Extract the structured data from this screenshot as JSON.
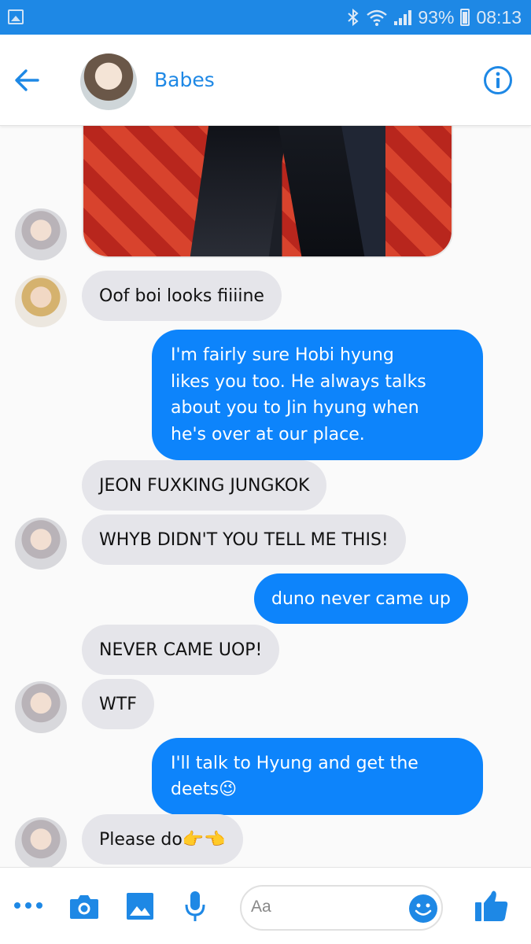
{
  "status_bar": {
    "battery": "93%",
    "time": "08:13",
    "icons": [
      "gallery-icon",
      "bluetooth-icon",
      "wifi-icon",
      "signal-icon",
      "battery-icon"
    ]
  },
  "header": {
    "contact_name": "Babes",
    "icons": [
      "back-arrow-icon",
      "info-icon"
    ]
  },
  "messages": [
    {
      "side": "in",
      "text": "Oof boi looks fiiiine"
    },
    {
      "side": "out",
      "lines": [
        "I'm fairly sure Hobi hyung",
        "likes you too. He always talks",
        "about you to Jin hyung when",
        "he's over at our place."
      ]
    },
    {
      "side": "in",
      "text": "JEON FUXKING JUNGKOK"
    },
    {
      "side": "in",
      "text": "WHYB DIDN'T YOU TELL ME THIS!"
    },
    {
      "side": "out",
      "text": "duno never came up"
    },
    {
      "side": "in",
      "text": "NEVER CAME UOP!"
    },
    {
      "side": "in",
      "text": "WTF"
    },
    {
      "side": "out",
      "lines": [
        "I'll talk to Hyung and get the",
        "deets😉"
      ]
    },
    {
      "side": "in",
      "text": "Please do👉👈"
    }
  ],
  "composer": {
    "placeholder": "Aa",
    "icons": [
      "more-icon",
      "camera-icon",
      "image-icon",
      "microphone-icon",
      "emoji-icon",
      "thumbs-up-icon"
    ]
  },
  "colors": {
    "accent": "#1e88e5",
    "outgoing_bubble": "#0d84fb",
    "incoming_bubble": "#e5e5ea"
  }
}
